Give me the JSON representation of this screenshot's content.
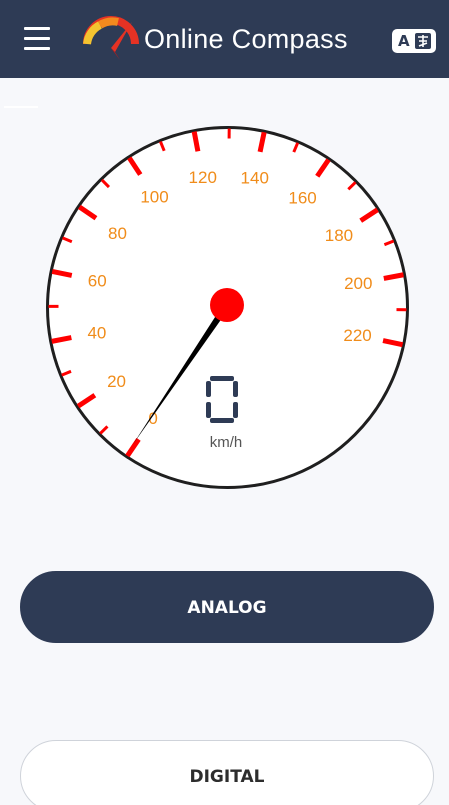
{
  "header": {
    "app_title": "Online Compass",
    "menu_icon": "hamburger-menu-icon",
    "logo_icon": "speedometer-logo-icon",
    "translate_icon": "translate-icon",
    "translate_label": "A"
  },
  "gauge": {
    "tick_labels": [
      "0",
      "20",
      "40",
      "60",
      "80",
      "100",
      "120",
      "140",
      "160",
      "180",
      "200",
      "220"
    ],
    "value_min": 0,
    "value_max": 220,
    "current_speed": 0,
    "speed_display": "0",
    "unit": "km/h",
    "colors": {
      "ticks": "#ff0000",
      "labels": "#f08c1a",
      "needle": "#000000",
      "hub": "#ff0000",
      "dial_border": "#1f1f1f"
    }
  },
  "buttons": {
    "analog_label": "ANALOG",
    "digital_label": "DIGITAL"
  },
  "colors": {
    "header_bg": "#2e3b55",
    "page_bg": "#f7f8fb"
  }
}
